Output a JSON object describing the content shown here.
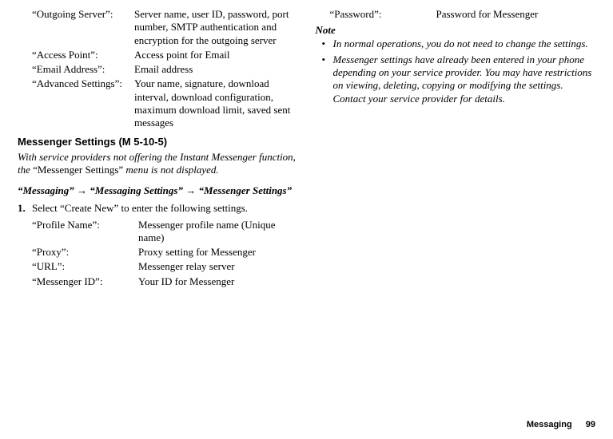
{
  "left": {
    "settings1": [
      {
        "label": "“Outgoing Server”:",
        "desc": "Server name, user ID, password, port number, SMTP authentication and encryption for the outgoing server"
      },
      {
        "label": "“Access Point”:",
        "desc": "Access point for Email"
      },
      {
        "label": "“Email Address”:",
        "desc": "Email address"
      },
      {
        "label": "“Advanced Settings”:",
        "desc": "Your name, signature, download interval, download configuration, maximum download limit, saved sent messages"
      }
    ],
    "heading": "Messenger Settings",
    "heading_suffix": " (M 5-10-5)",
    "intro_a": "With service providers not offering the Instant Messenger function, the ",
    "intro_quote": "“Messenger Settings”",
    "intro_b": " menu is not displayed.",
    "navpath": "“Messaging” → “Messaging Settings” → “Messenger Settings”",
    "step_num": "1.",
    "step_text": "Select “Create New” to enter the following settings.",
    "settings2": [
      {
        "label": "“Profile Name”:",
        "desc": "Messenger profile name (Unique name)"
      },
      {
        "label": "“Proxy”:",
        "desc": "Proxy setting for Messenger"
      },
      {
        "label": "“URL”:",
        "desc": "Messenger relay server"
      },
      {
        "label": "“Messenger ID”:",
        "desc": "Your ID for Messenger"
      }
    ]
  },
  "right": {
    "settings": [
      {
        "label": "“Password”:",
        "desc": "Password for Messenger"
      }
    ],
    "note_head": "Note",
    "notes": [
      "In normal operations, you do not need to change the settings.",
      "Messenger settings have already been entered in your phone depending on your service provider. You may have restrictions on viewing, deleting, copying or modifying the settings. Contact your service provider for details."
    ]
  },
  "footer": {
    "section": "Messaging",
    "page": "99"
  }
}
